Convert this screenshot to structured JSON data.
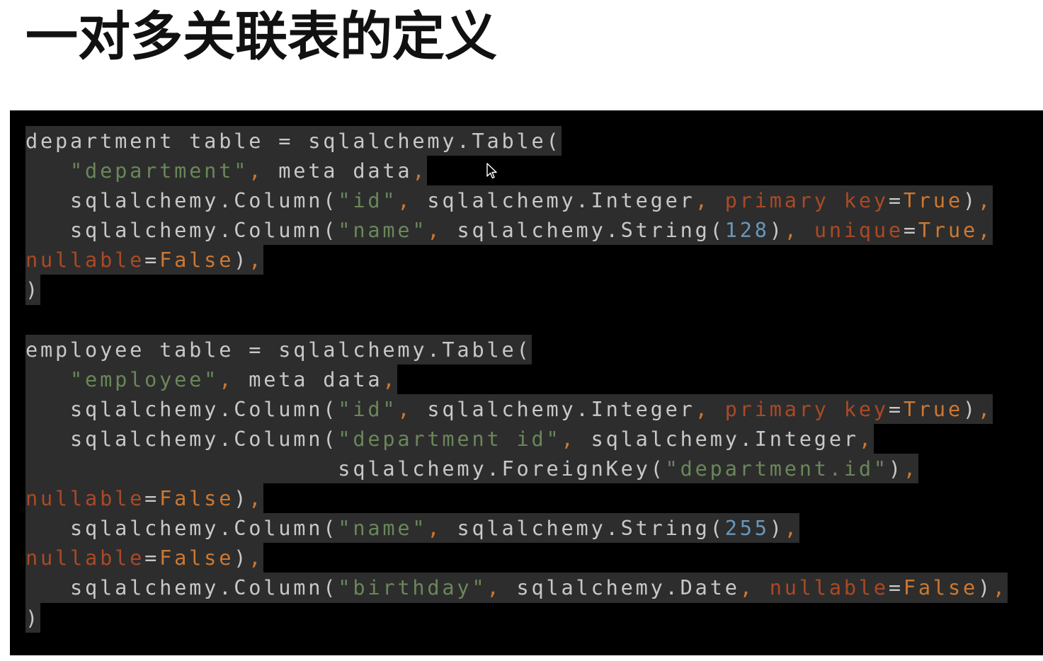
{
  "title": "一对多关联表的定义",
  "colors": {
    "background": "#ffffff",
    "code_background": "#000000",
    "selection": "#2d2d2d",
    "text": "#c8c8c8",
    "string": "#6a8759",
    "number": "#6897bb",
    "keyword": "#cc7832",
    "kwarg": "#aa4926"
  },
  "code": {
    "lines": [
      [
        {
          "t": "department table = sqlalchemy.Table(",
          "c": "plain"
        }
      ],
      [
        {
          "t": "   ",
          "c": "plain"
        },
        {
          "t": "\"department\"",
          "c": "str"
        },
        {
          "t": ", ",
          "c": "punct"
        },
        {
          "t": "meta data",
          "c": "plain"
        },
        {
          "t": ",",
          "c": "punct"
        }
      ],
      [
        {
          "t": "   sqlalchemy.Column(",
          "c": "plain"
        },
        {
          "t": "\"id\"",
          "c": "str"
        },
        {
          "t": ", ",
          "c": "punct"
        },
        {
          "t": "sqlalchemy.Integer",
          "c": "plain"
        },
        {
          "t": ", ",
          "c": "punct"
        },
        {
          "t": "primary key",
          "c": "kwarg"
        },
        {
          "t": "=",
          "c": "plain"
        },
        {
          "t": "True",
          "c": "kw"
        },
        {
          "t": ")",
          "c": "plain"
        },
        {
          "t": ",",
          "c": "punct"
        }
      ],
      [
        {
          "t": "   sqlalchemy.Column(",
          "c": "plain"
        },
        {
          "t": "\"name\"",
          "c": "str"
        },
        {
          "t": ", ",
          "c": "punct"
        },
        {
          "t": "sqlalchemy.String(",
          "c": "plain"
        },
        {
          "t": "128",
          "c": "num"
        },
        {
          "t": ")",
          "c": "plain"
        },
        {
          "t": ", ",
          "c": "punct"
        },
        {
          "t": "unique",
          "c": "kwarg"
        },
        {
          "t": "=",
          "c": "plain"
        },
        {
          "t": "True",
          "c": "kw"
        },
        {
          "t": ",",
          "c": "punct"
        }
      ],
      [
        {
          "t": "nullable",
          "c": "kwarg"
        },
        {
          "t": "=",
          "c": "plain"
        },
        {
          "t": "False",
          "c": "kw"
        },
        {
          "t": ")",
          "c": "plain"
        },
        {
          "t": ",",
          "c": "punct"
        }
      ],
      [
        {
          "t": ")",
          "c": "plain"
        }
      ],
      [],
      [
        {
          "t": "employee table = sqlalchemy.Table(",
          "c": "plain"
        }
      ],
      [
        {
          "t": "   ",
          "c": "plain"
        },
        {
          "t": "\"employee\"",
          "c": "str"
        },
        {
          "t": ", ",
          "c": "punct"
        },
        {
          "t": "meta data",
          "c": "plain"
        },
        {
          "t": ",",
          "c": "punct"
        }
      ],
      [
        {
          "t": "   sqlalchemy.Column(",
          "c": "plain"
        },
        {
          "t": "\"id\"",
          "c": "str"
        },
        {
          "t": ", ",
          "c": "punct"
        },
        {
          "t": "sqlalchemy.Integer",
          "c": "plain"
        },
        {
          "t": ", ",
          "c": "punct"
        },
        {
          "t": "primary key",
          "c": "kwarg"
        },
        {
          "t": "=",
          "c": "plain"
        },
        {
          "t": "True",
          "c": "kw"
        },
        {
          "t": ")",
          "c": "plain"
        },
        {
          "t": ",",
          "c": "punct"
        }
      ],
      [
        {
          "t": "   sqlalchemy.Column(",
          "c": "plain"
        },
        {
          "t": "\"department id\"",
          "c": "str"
        },
        {
          "t": ", ",
          "c": "punct"
        },
        {
          "t": "sqlalchemy.Integer",
          "c": "plain"
        },
        {
          "t": ",",
          "c": "punct"
        }
      ],
      [
        {
          "t": "                     sqlalchemy.ForeignKey(",
          "c": "plain"
        },
        {
          "t": "\"department.id\"",
          "c": "str"
        },
        {
          "t": ")",
          "c": "plain"
        },
        {
          "t": ",",
          "c": "punct"
        }
      ],
      [
        {
          "t": "nullable",
          "c": "kwarg"
        },
        {
          "t": "=",
          "c": "plain"
        },
        {
          "t": "False",
          "c": "kw"
        },
        {
          "t": ")",
          "c": "plain"
        },
        {
          "t": ",",
          "c": "punct"
        }
      ],
      [
        {
          "t": "   sqlalchemy.Column(",
          "c": "plain"
        },
        {
          "t": "\"name\"",
          "c": "str"
        },
        {
          "t": ", ",
          "c": "punct"
        },
        {
          "t": "sqlalchemy.String(",
          "c": "plain"
        },
        {
          "t": "255",
          "c": "num"
        },
        {
          "t": ")",
          "c": "plain"
        },
        {
          "t": ",",
          "c": "punct"
        }
      ],
      [
        {
          "t": "nullable",
          "c": "kwarg"
        },
        {
          "t": "=",
          "c": "plain"
        },
        {
          "t": "False",
          "c": "kw"
        },
        {
          "t": ")",
          "c": "plain"
        },
        {
          "t": ",",
          "c": "punct"
        }
      ],
      [
        {
          "t": "   sqlalchemy.Column(",
          "c": "plain"
        },
        {
          "t": "\"birthday\"",
          "c": "str"
        },
        {
          "t": ", ",
          "c": "punct"
        },
        {
          "t": "sqlalchemy.Date",
          "c": "plain"
        },
        {
          "t": ", ",
          "c": "punct"
        },
        {
          "t": "nullable",
          "c": "kwarg"
        },
        {
          "t": "=",
          "c": "plain"
        },
        {
          "t": "False",
          "c": "kw"
        },
        {
          "t": ")",
          "c": "plain"
        },
        {
          "t": ",",
          "c": "punct"
        }
      ],
      [
        {
          "t": ")",
          "c": "plain"
        }
      ]
    ]
  },
  "cursor_icon": "mouse-pointer-icon"
}
